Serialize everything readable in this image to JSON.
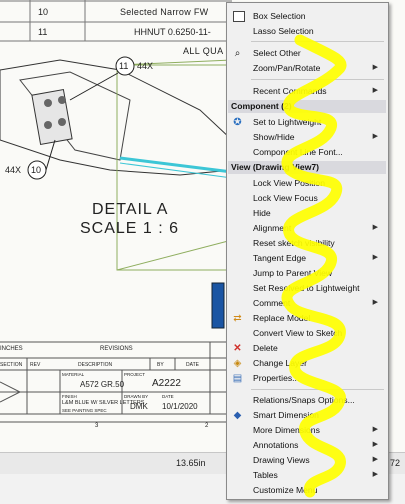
{
  "bom_table": {
    "rows": [
      {
        "num": "10",
        "desc": "Selected Narrow FW"
      },
      {
        "num": "11",
        "desc": "HHNUT 0.6250-11-"
      }
    ],
    "note": "ALL QUA"
  },
  "drawing": {
    "balloon_11": "11",
    "balloon_11_qty": "44X",
    "balloon_10": "10",
    "balloon_10_qty": "44X",
    "detail_title": "DETAIL A",
    "detail_scale": "SCALE 1 : 6"
  },
  "title_block": {
    "revisions": "REVISIONS",
    "inches": "INCHES",
    "col_section": "SECTION",
    "col_rev": "REV",
    "col_description": "DESCRIPTION",
    "col_by": "BY",
    "col_date": "DATE",
    "material_label": "MATERIAL",
    "material_value": "A572 GR.50",
    "project_label": "PROJECT",
    "project_value": "A2222",
    "finish_label": "FINISH",
    "finish_value": "L&M BLUE W/ SILVER LETTERS",
    "finish_value2": "SEE PAINTING SPEC",
    "drawn_by_label": "DRAWN BY",
    "drawn_by_value": "DMK",
    "date_label": "DATE",
    "date_value": "10/1/2020",
    "zone_3": "3",
    "zone_2": "2"
  },
  "status_bar": {
    "value": "13.65in",
    "value2": "72"
  },
  "context_menu": {
    "items_top": [
      {
        "label": "Box Selection",
        "icon": "box-selection-icon",
        "glyph": "▢"
      },
      {
        "label": "Lasso Selection",
        "icon": "",
        "glyph": ""
      }
    ],
    "select_other": "Select Other",
    "zoom_pan_rotate": "Zoom/Pan/Rotate",
    "recent_commands": "Recent Commands",
    "component_header": "Component (2)",
    "set_lightweight": "Set to Lightweight",
    "show_hide": "Show/Hide",
    "component_line_font": "Component Line Font...",
    "view_header": "View (Drawing View7)",
    "view_items": [
      "Lock View Position",
      "Lock View Focus",
      "Hide",
      "Alignment",
      "Reset sketch visibility",
      "Tangent Edge",
      "Jump to Parent View",
      "Set Resolved to Lightweight",
      "Comment",
      "Replace Model",
      "Convert View to Sketch",
      "Delete",
      "Change Layer",
      "Properties..."
    ],
    "bottom_items": [
      "Relations/Snaps Options...",
      "Smart Dimension",
      "More Dimensions",
      "Annotations",
      "Drawing Views",
      "Tables",
      "Customize Menu"
    ],
    "colors": {
      "menu_bg": "#f0f0f0",
      "header_bg": "#d9d9de",
      "highlight_scribble": "#ffff00",
      "delete_red": "#d0302a"
    }
  }
}
